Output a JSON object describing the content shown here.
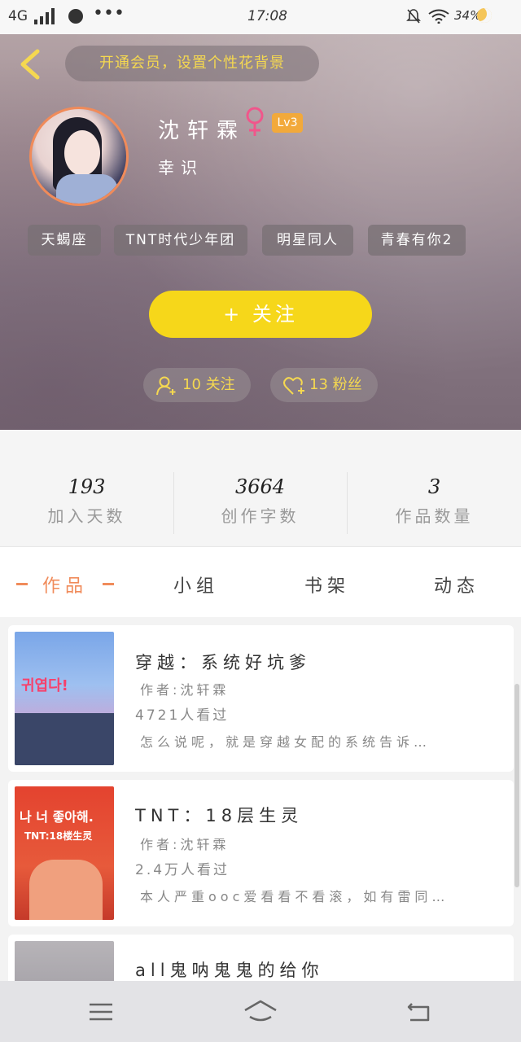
{
  "status_bar": {
    "network": "4G",
    "time": "17:08",
    "battery": "34%"
  },
  "header": {
    "banner_text": "开通会员，设置个性花背景",
    "name": "沈轩霖",
    "level": "Lv3",
    "subtitle": "幸识",
    "tags": [
      "天蝎座",
      "TNT时代少年团",
      "明星同人",
      "青春有你2"
    ],
    "follow_button": "+   关注",
    "following_label": "10 关注",
    "fans_label": "13 粉丝"
  },
  "stats": [
    {
      "value": "193",
      "label": "加入天数"
    },
    {
      "value": "3664",
      "label": "创作字数"
    },
    {
      "value": "3",
      "label": "作品数量"
    }
  ],
  "tabs": [
    {
      "label": "作品",
      "active": true
    },
    {
      "label": "小组",
      "active": false
    },
    {
      "label": "书架",
      "active": false
    },
    {
      "label": "动态",
      "active": false
    }
  ],
  "works": [
    {
      "title": "穿越：系统好坑爹",
      "author": "作者:沈轩霖",
      "views": "4721人看过",
      "desc": "怎么说呢，就是穿越女配的系统告诉…",
      "cover_text": "귀엽다!"
    },
    {
      "title": "TNT：18层生灵",
      "author": "作者:沈轩霖",
      "views": "2.4万人看过",
      "desc": "本人严重ooc爱看看不看滚，如有雷同…",
      "cover_text": "나 너 좋아해.",
      "cover_sub": "TNT:18楼生灵"
    },
    {
      "title": "all鬼呐鬼鬼的给你"
    }
  ],
  "colors": {
    "accent": "#f6d71a",
    "tab_active": "#f08b5a",
    "level_badge": "#f2a93b",
    "banner_text": "#f5d850"
  }
}
